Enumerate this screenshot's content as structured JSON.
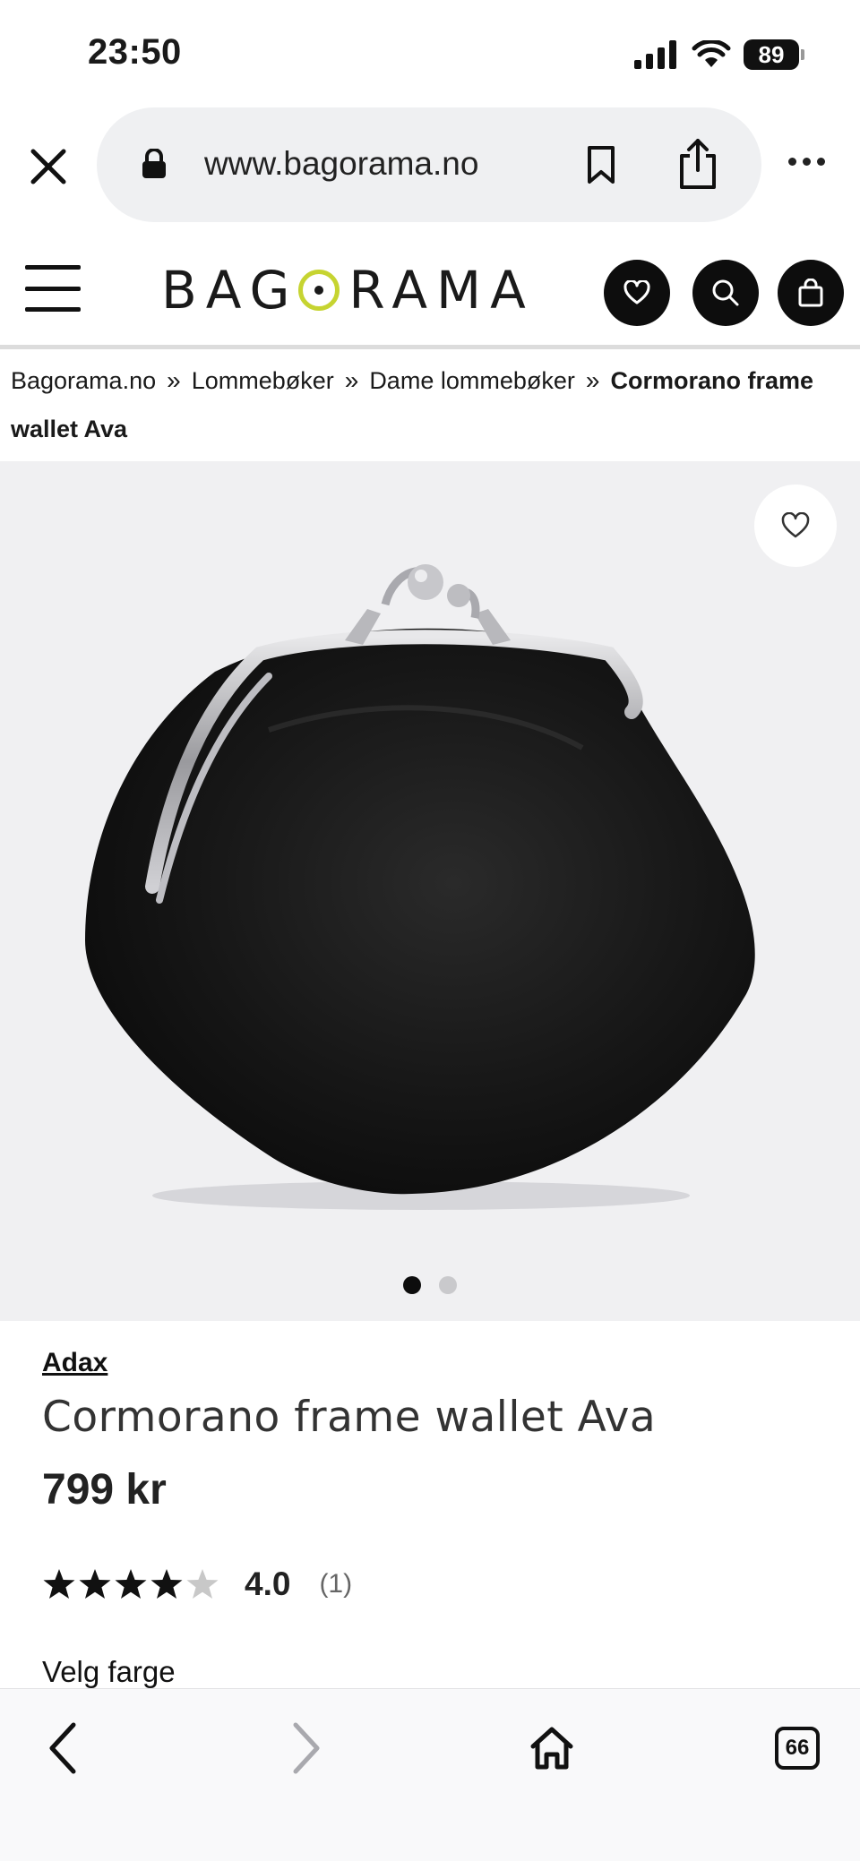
{
  "status_bar": {
    "time": "23:50",
    "battery": "89"
  },
  "browser": {
    "url": "www.bagorama.no",
    "tab_count": "66"
  },
  "site": {
    "logo": {
      "before": "BAG",
      "after": "RAMA"
    }
  },
  "breadcrumb": {
    "items": [
      "Bagorama.no",
      "Lommebøker",
      "Dame lommebøker"
    ],
    "separator": "»",
    "current": "Cormorano frame wallet Ava"
  },
  "carousel": {
    "slide_count": 2,
    "active_index": 0
  },
  "product": {
    "brand": "Adax",
    "name": "Cormorano frame wallet Ava",
    "price": "799 kr",
    "rating_value": "4.0",
    "rating_stars": 4,
    "rating_max": 5,
    "review_count": "(1)",
    "choose_color_label": "Velg farge"
  },
  "colors": {
    "accent_logo": "#c6d431",
    "header_buttons": "#0d0d0d",
    "image_background": "#f0f0f2"
  }
}
